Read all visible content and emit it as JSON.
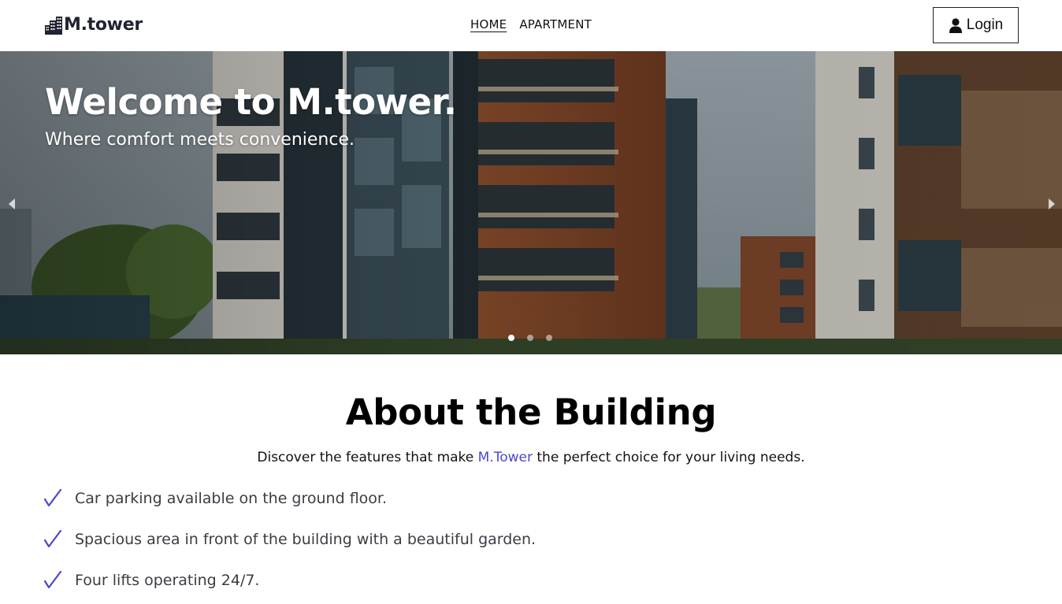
{
  "brand": {
    "name": "M.tower",
    "icon": "building-icon"
  },
  "nav": {
    "links": [
      {
        "label": "HOME",
        "active": true
      },
      {
        "label": "APARTMENT",
        "active": false
      }
    ],
    "login_label": "Login",
    "login_icon": "user-icon"
  },
  "hero": {
    "title": "Welcome to M.tower.",
    "subtitle": "Where comfort meets convenience.",
    "slide_count": 3,
    "active_slide": 1,
    "prev_icon": "chevron-left-icon",
    "next_icon": "chevron-right-icon"
  },
  "about": {
    "title": "About the Building",
    "desc_before": "Discover the features that make ",
    "desc_highlight": "M.Tower",
    "desc_after": " the perfect choice for your living needs.",
    "features": [
      "Car parking available on the ground floor.",
      "Spacious area in front of the building with a beautiful garden.",
      "Four lifts operating 24/7."
    ],
    "check_icon": "check-icon"
  },
  "colors": {
    "accent": "#4a48cf",
    "text_dark": "#1f2430",
    "white": "#ffffff"
  }
}
